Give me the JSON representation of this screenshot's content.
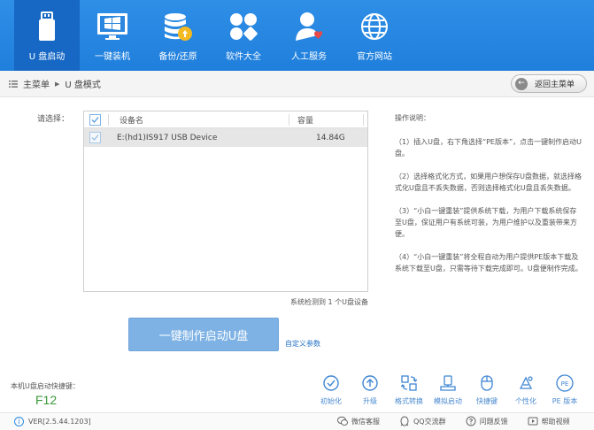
{
  "toolbar": {
    "items": [
      {
        "label": "U 盘启动",
        "icon": "usb-drive-icon",
        "active": true
      },
      {
        "label": "一键装机",
        "icon": "windows-icon",
        "active": false
      },
      {
        "label": "备份/还原",
        "icon": "database-backup-icon",
        "active": false
      },
      {
        "label": "软件大全",
        "icon": "apps-grid-icon",
        "active": false
      },
      {
        "label": "人工服务",
        "icon": "support-person-icon",
        "active": false
      },
      {
        "label": "官方网站",
        "icon": "globe-icon",
        "active": false
      }
    ],
    "colors": {
      "bar": "#2389e0",
      "active": "#1668c4"
    }
  },
  "breadcrumb": {
    "home": "主菜单",
    "current": "U 盘模式"
  },
  "back_button": {
    "label": "返回主菜单"
  },
  "select_label": "请选择：",
  "device_table": {
    "headers": {
      "name": "设备名",
      "size": "容量"
    },
    "rows": [
      {
        "name": "E:(hd1)IS917 USB Device",
        "size": "14.84G",
        "checked": true
      }
    ]
  },
  "detect_text": "系统检测到 1 个U盘设备",
  "make_button": "一键制作启动U盘",
  "custom_params": "自定义参数",
  "instructions": {
    "title": "操作说明：",
    "paragraphs": [
      "（1）插入U盘，右下角选择“PE版本”，点击一键制作启动U盘。",
      "（2）选择格式化方式，如果用户想保存U盘数据，就选择格式化U盘且不丢失数据，否则选择格式化U盘且丢失数据。",
      "（3）“小白一键重装”提供系统下载，为用户下载系统保存至U盘，保证用户有系统可装，为用户维护以及重装带来方便。",
      "（4）“小白一键重装”将全程自动为用户提供PE版本下载及系统下载至U盘，只需等待下载完成即可。U盘便制作完成。"
    ]
  },
  "shortcut": {
    "label": "本机U盘启动快捷键：",
    "key": "F12"
  },
  "tools": [
    {
      "label": "初始化",
      "icon": "check-circle-icon"
    },
    {
      "label": "升级",
      "icon": "upgrade-arrow-icon"
    },
    {
      "label": "格式转换",
      "icon": "convert-icon"
    },
    {
      "label": "模拟启动",
      "icon": "simulate-boot-icon"
    },
    {
      "label": "快捷键",
      "icon": "mouse-icon"
    },
    {
      "label": "个性化",
      "icon": "personalize-icon"
    },
    {
      "label": "PE 版本",
      "icon": "pe-version-icon"
    }
  ],
  "status": {
    "version": "VER[2.5.44.1203]",
    "links": [
      {
        "label": "微信客服",
        "icon": "wechat-icon"
      },
      {
        "label": "QQ交流群",
        "icon": "qq-icon"
      },
      {
        "label": "问题反馈",
        "icon": "feedback-icon"
      },
      {
        "label": "帮助视频",
        "icon": "video-icon"
      }
    ]
  }
}
